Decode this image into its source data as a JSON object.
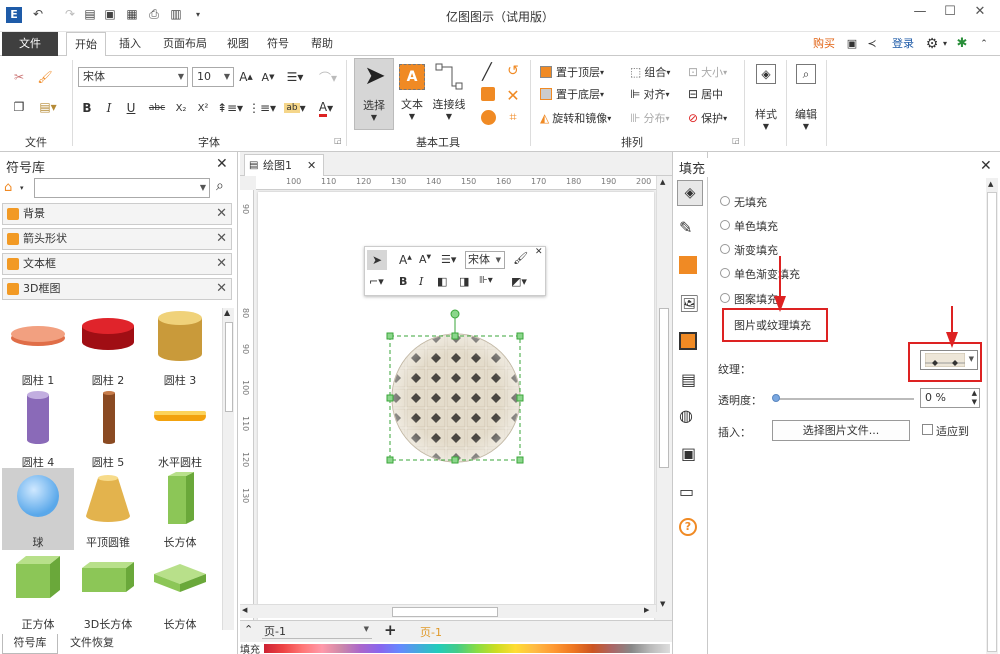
{
  "window": {
    "title": "亿图图示（试用版）"
  },
  "menu": {
    "file": "文件",
    "start": "开始",
    "insert": "插入",
    "layout": "页面布局",
    "view": "视图",
    "symbol": "符号",
    "help": "帮助",
    "buy": "购买",
    "login": "登录"
  },
  "ribbon": {
    "groups": {
      "file": "文件",
      "font": "字体",
      "basic_tools": "基本工具",
      "arrange": "排列"
    },
    "font_name": "宋体",
    "font_size": "10",
    "font_buttons": [
      "B",
      "I",
      "U",
      "abc",
      "X₂",
      "X²"
    ],
    "select": "选择",
    "text": "文本",
    "connector": "连接线",
    "arrange": {
      "to_top": "置于顶层",
      "to_bottom": "置于底层",
      "rotate": "旋转和镜像",
      "group": "组合",
      "align": "对齐",
      "distribute": "分布",
      "size": "大小",
      "center": "居中",
      "protect": "保护"
    },
    "style": "样式",
    "edit": "编辑"
  },
  "library": {
    "title": "符号库",
    "categories": [
      "背景",
      "箭头形状",
      "文本框",
      "3D框图"
    ],
    "shapes": [
      "圆柱 1",
      "圆柱 2",
      "圆柱 3",
      "圆柱 4",
      "圆柱 5",
      "水平圆柱",
      "球",
      "平顶圆锥",
      "长方体",
      "正方体",
      "3D长方体",
      "长方体"
    ],
    "bottom_tabs": [
      "符号库",
      "文件恢复"
    ]
  },
  "canvas": {
    "tab": "绘图1",
    "ruler_h": [
      "100",
      "110",
      "120",
      "130",
      "140",
      "150",
      "160",
      "170",
      "180",
      "190",
      "200"
    ],
    "ruler_v": [
      "90",
      "80",
      "90",
      "100",
      "110",
      "120",
      "130"
    ],
    "mini_toolbar": {
      "font": "宋体"
    },
    "page_select": "页-1",
    "page_tab": "页-1",
    "fill_label": "填充"
  },
  "fill": {
    "title": "填充",
    "options": [
      "无填充",
      "单色填充",
      "渐变填充",
      "单色渐变填充",
      "图案填充",
      "图片或纹理填充"
    ],
    "texture_label": "纹理：",
    "transparency_label": "透明度：",
    "transparency_value": "0 %",
    "insert_label": "插入：",
    "choose_button": "选择图片文件...",
    "fit_label": "适应到"
  },
  "colors": {
    "accent": "#d22222",
    "orange": "#f08a24",
    "brand_blue": "#1e5ba8"
  }
}
